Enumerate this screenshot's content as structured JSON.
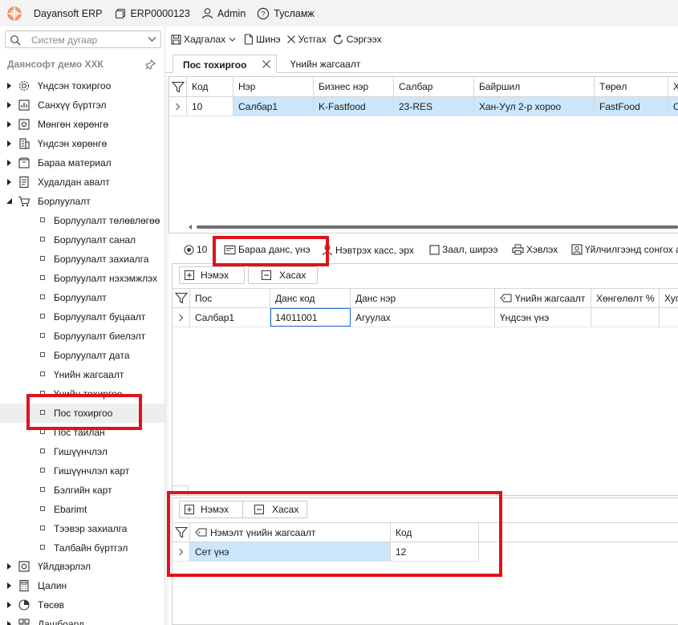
{
  "titlebar": {
    "app_name": "Dayansoft ERP",
    "erp_code": "ERP0000123",
    "user": "Admin",
    "help": "Тусламж"
  },
  "sidebar": {
    "search_placeholder": "Систем дугаар",
    "company": "Даянсофт демо ХХК",
    "top_items": [
      {
        "label": "Үндсэн тохиргоо",
        "icon": "gear-icon"
      },
      {
        "label": "Санхүү бүртгэл",
        "icon": "finance-icon"
      },
      {
        "label": "Мөнгөн хөрөнгө",
        "icon": "cash-icon"
      },
      {
        "label": "Үндсэн хөрөнгө",
        "icon": "building-icon"
      },
      {
        "label": "Бараа материал",
        "icon": "box-icon"
      },
      {
        "label": "Худалдан авалт",
        "icon": "purchase-icon"
      },
      {
        "label": "Борлуулалт",
        "icon": "cart-icon"
      }
    ],
    "sales_children": [
      "Борлуулалт төлөвлөгөө",
      "Борлуулалт санал",
      "Борлуулалт захиалга",
      "Борлуулалт нэхэмжлэх",
      "Борлуулалт",
      "Борлуулалт буцаалт",
      "Борлуулалт биелэлт",
      "Борлуулалт дата",
      "Үнийн жагсаалт",
      "Үнийн тохиргоо",
      "Пос тохиргоо",
      "Пос тайлан",
      "Гишүүнчлэл",
      "Гишүүнчлэл карт",
      "Бэлгийн карт",
      "Ebarimt",
      "Тээвэр захиалга",
      "Талбайн бүртгэл"
    ],
    "bottom_items": [
      {
        "label": "Үйлдвэрлэл",
        "icon": "factory-icon"
      },
      {
        "label": "Цалин",
        "icon": "calculator-icon"
      },
      {
        "label": "Төсөв",
        "icon": "pie-icon"
      },
      {
        "label": "Дашбоард",
        "icon": "dashboard-icon"
      }
    ]
  },
  "toolbar": {
    "save": "Хадгалах",
    "new": "Шинэ",
    "delete": "Устгах",
    "refresh": "Сэргээх"
  },
  "tabs": {
    "active": "Пос тохиргоо",
    "second": "Үнийн жагсаалт"
  },
  "pos_grid": {
    "columns": [
      "Код",
      "Нэр",
      "Бизнес нэр",
      "Салбар",
      "Байршил",
      "Төрөл",
      "Х"
    ],
    "rows": [
      [
        "10",
        "Салбар1",
        "K-Fastfood",
        "23-RES",
        "Хан-Уул 2-р хороо",
        "FastFood",
        "С"
      ]
    ]
  },
  "subtabs": {
    "record": "10",
    "goods": "Бараа данс, үнэ",
    "cashier": "Нэвтрэх касс, эрх",
    "hall": "Заал, ширээ",
    "print": "Хэвлэх",
    "service": "Үйлчилгээнд сонгох а"
  },
  "account_panel": {
    "add": "Нэмэх",
    "remove": "Хасах",
    "columns": [
      "Пос",
      "Данс код",
      "Данс нэр",
      "Үнийн жагсаалт",
      "Хөнгөлөлт %",
      "Хуг"
    ],
    "rows": [
      [
        "Салбар1",
        "14011001",
        "Агуулах",
        "Үндсэн үнэ",
        "",
        ""
      ]
    ]
  },
  "extra_panel": {
    "add": "Нэмэх",
    "remove": "Хасах",
    "columns": [
      "Нэмэлт үнийн жагсаалт",
      "Код"
    ],
    "rows": [
      [
        "Сет үнэ",
        "12"
      ]
    ]
  },
  "colors": {
    "highlight": "#e0121b",
    "selection": "#cce6fb"
  }
}
